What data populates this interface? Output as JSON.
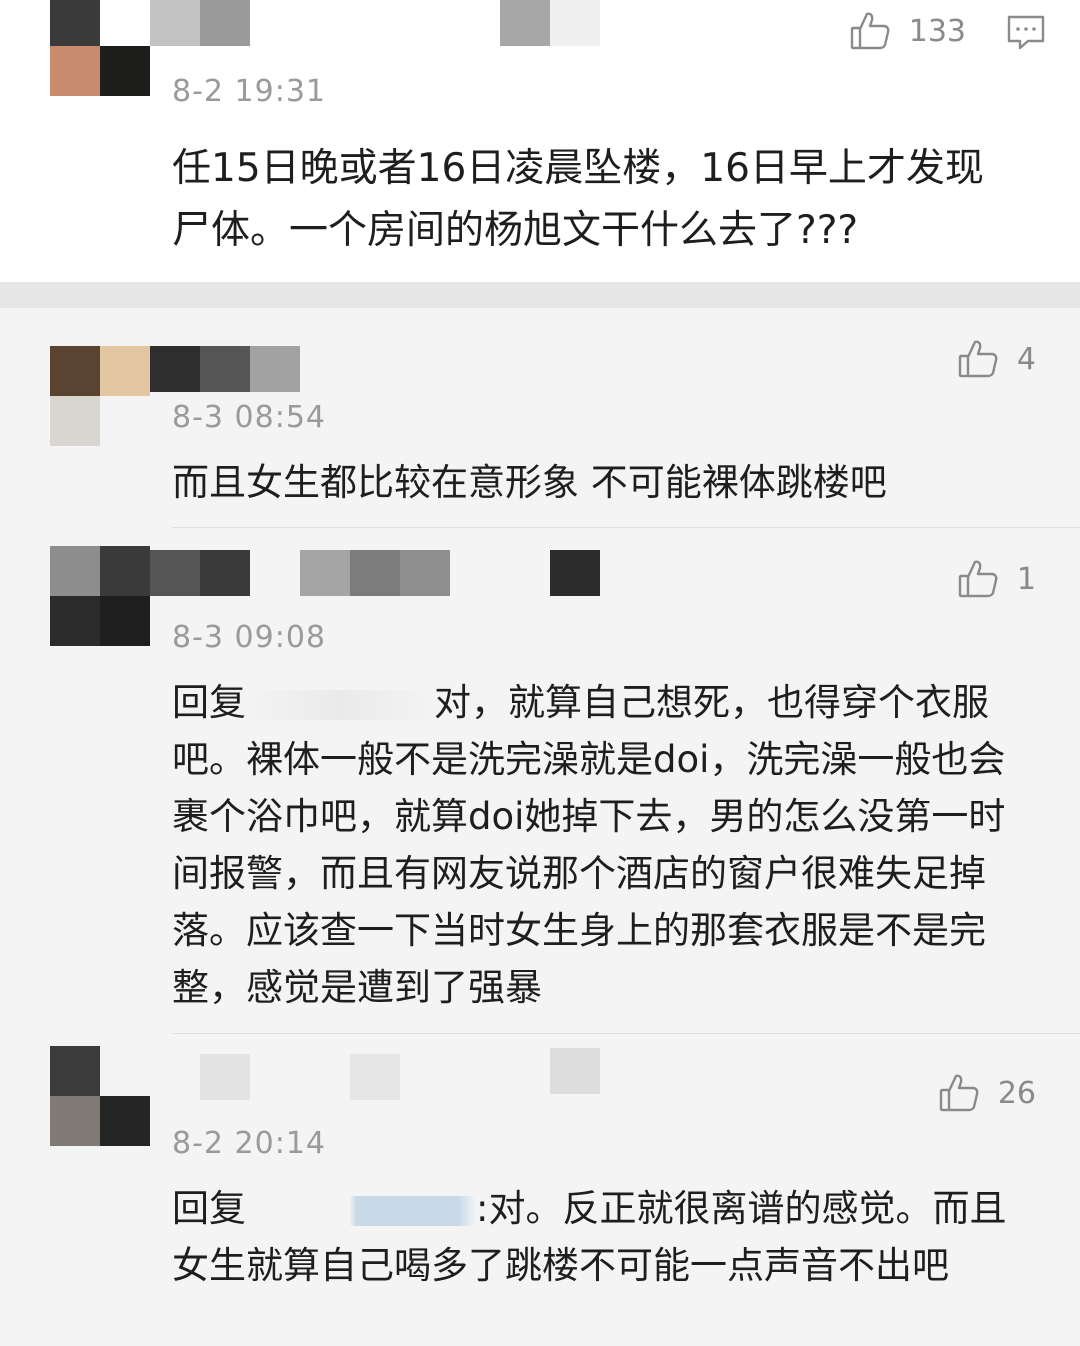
{
  "comments": [
    {
      "timestamp": "8-2 19:31",
      "likes": "133",
      "text": "任15日晚或者16日凌晨坠楼，16日早上才发现\n尸体。一个房间的杨旭文干什么去了???"
    },
    {
      "timestamp": "8-3 08:54",
      "likes": "4",
      "text": "而且女生都比较在意形象 不可能裸体跳楼吧"
    },
    {
      "timestamp": "8-3 09:08",
      "likes": "1",
      "text_prefix": "回复",
      "text_after_mask": "对，就算自己想死，也得穿个衣服",
      "text_rest": "吧。裸体一般不是洗完澡就是doi，洗完澡一般也会\n裹个浴巾吧，就算doi她掉下去，男的怎么没第一时\n间报警，而且有网友说那个酒店的窗户很难失足掉\n落。应该查一下当时女生身上的那套衣服是不是完\n整，感觉是遭到了强暴"
    },
    {
      "timestamp": "8-2 20:14",
      "likes": "26",
      "text_prefix": "回复",
      "text_after_mask": ":对。反正就很离谱的感觉。而且",
      "text_rest": "女生就算自己喝多了跳楼不可能一点声音不出吧"
    }
  ],
  "icons": {
    "like": "thumbs-up-icon",
    "reply": "comment-bubble-icon"
  },
  "colors": {
    "meta_gray": "#9a9a9a",
    "text": "#1e1e1e",
    "top_card_bg": "#ffffff",
    "reply_bg": "#f4f4f4"
  }
}
